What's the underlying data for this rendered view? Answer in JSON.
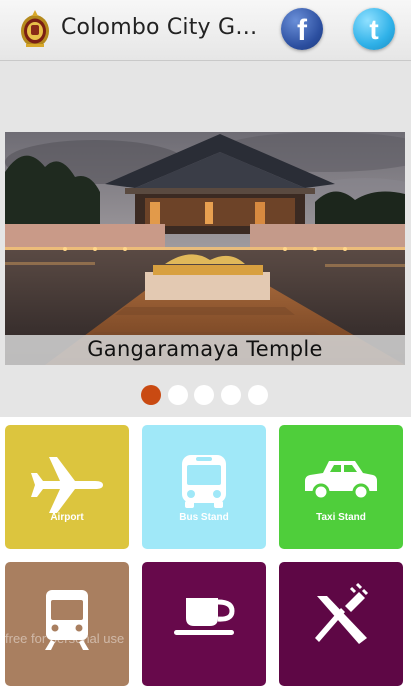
{
  "header": {
    "title": "Colombo City Guide",
    "logo_icon": "sri-lanka-emblem-icon"
  },
  "social": [
    {
      "name": "facebook",
      "glyph": "f"
    },
    {
      "name": "twitter",
      "glyph": "t"
    }
  ],
  "carousel": {
    "caption": "Gangaramaya Temple",
    "pages": 5,
    "active_page": 1
  },
  "tiles": [
    {
      "label": "Airport",
      "icon": "airplane-icon",
      "color": "#dcc53e"
    },
    {
      "label": "Bus Stand",
      "icon": "bus-icon",
      "color": "#a0e8f8"
    },
    {
      "label": "Taxi Stand",
      "icon": "taxi-icon",
      "color": "#4fce3b"
    },
    {
      "label": "",
      "icon": "train-icon",
      "color": "#a97f60"
    },
    {
      "label": "",
      "icon": "coffee-cup-icon",
      "color": "#67094b"
    },
    {
      "label": "",
      "icon": "fork-knife-icon",
      "color": "#5e0745"
    }
  ],
  "watermark": "free for personal use"
}
